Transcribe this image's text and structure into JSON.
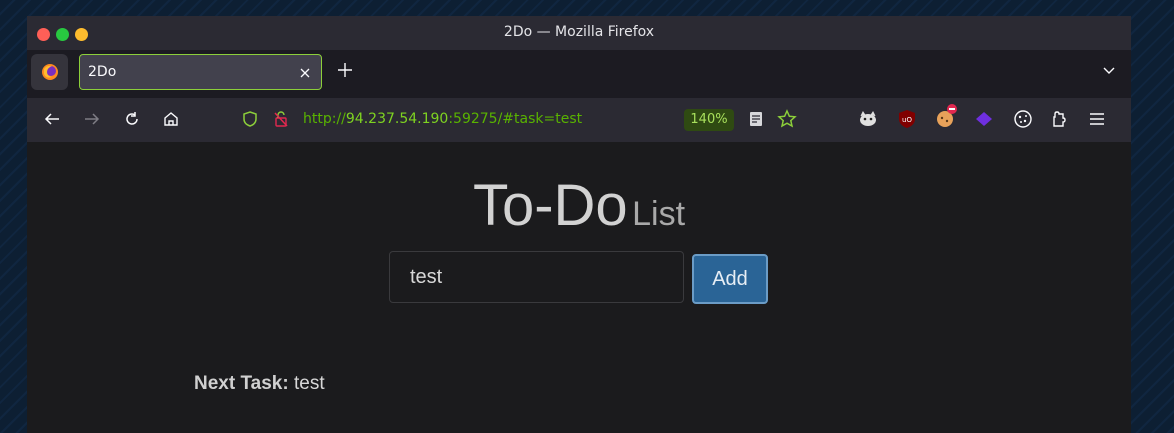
{
  "window": {
    "title": "2Do — Mozilla Firefox"
  },
  "tabs": [
    {
      "label": "2Do",
      "active": true
    }
  ],
  "navbar": {
    "url_scheme": "http://",
    "url_host": "94.237.54.190",
    "url_rest": ":59275/#task=test",
    "zoom": "140%"
  },
  "icons": {
    "titlebar": [
      "close-light",
      "maximize-light",
      "minimize-light"
    ],
    "tabbar": [
      "firefox-icon",
      "close-tab-icon",
      "plus-icon",
      "chevron-down-icon"
    ],
    "navbar": [
      "back-arrow-icon",
      "forward-arrow-icon",
      "reload-icon",
      "home-icon",
      "shield-icon",
      "insecure-lock-icon",
      "reader-view-icon",
      "star-icon"
    ],
    "extensions": [
      "extension-cat-icon",
      "ublock-icon",
      "extension-cookie-face-icon",
      "extension-diamond-icon",
      "cookie-icon",
      "extensions-icon",
      "menu-icon"
    ]
  },
  "colors": {
    "url_green": "#7ed321",
    "zoom_bg": "#2f4a12",
    "add_button": "#2a6496",
    "active_tab_border": "#8ccf3a"
  },
  "page": {
    "heading_big": "To-Do",
    "heading_small": "List",
    "input_value": "test",
    "add_label": "Add",
    "next_task_label": "Next Task:",
    "next_task_value": "test"
  }
}
